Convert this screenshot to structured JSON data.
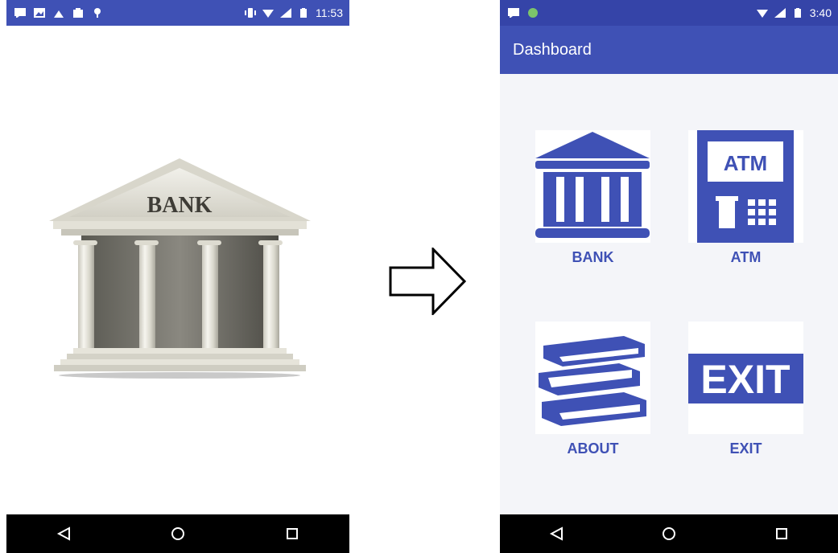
{
  "left_screen": {
    "status_time": "11:53",
    "bank_sign": "BANK"
  },
  "right_screen": {
    "status_time": "3:40",
    "title": "Dashboard",
    "tiles": [
      {
        "label": "BANK",
        "icon": "bank-icon"
      },
      {
        "label": "ATM",
        "icon": "atm-icon",
        "icon_text": "ATM"
      },
      {
        "label": "ABOUT",
        "icon": "books-icon"
      },
      {
        "label": "EXIT",
        "icon": "exit-icon",
        "icon_text": "EXIT"
      }
    ]
  },
  "colors": {
    "primary": "#3f51b5",
    "status_bar": "#3544a8",
    "nav_bar": "#000000",
    "tile_accent": "#3f51b5"
  }
}
